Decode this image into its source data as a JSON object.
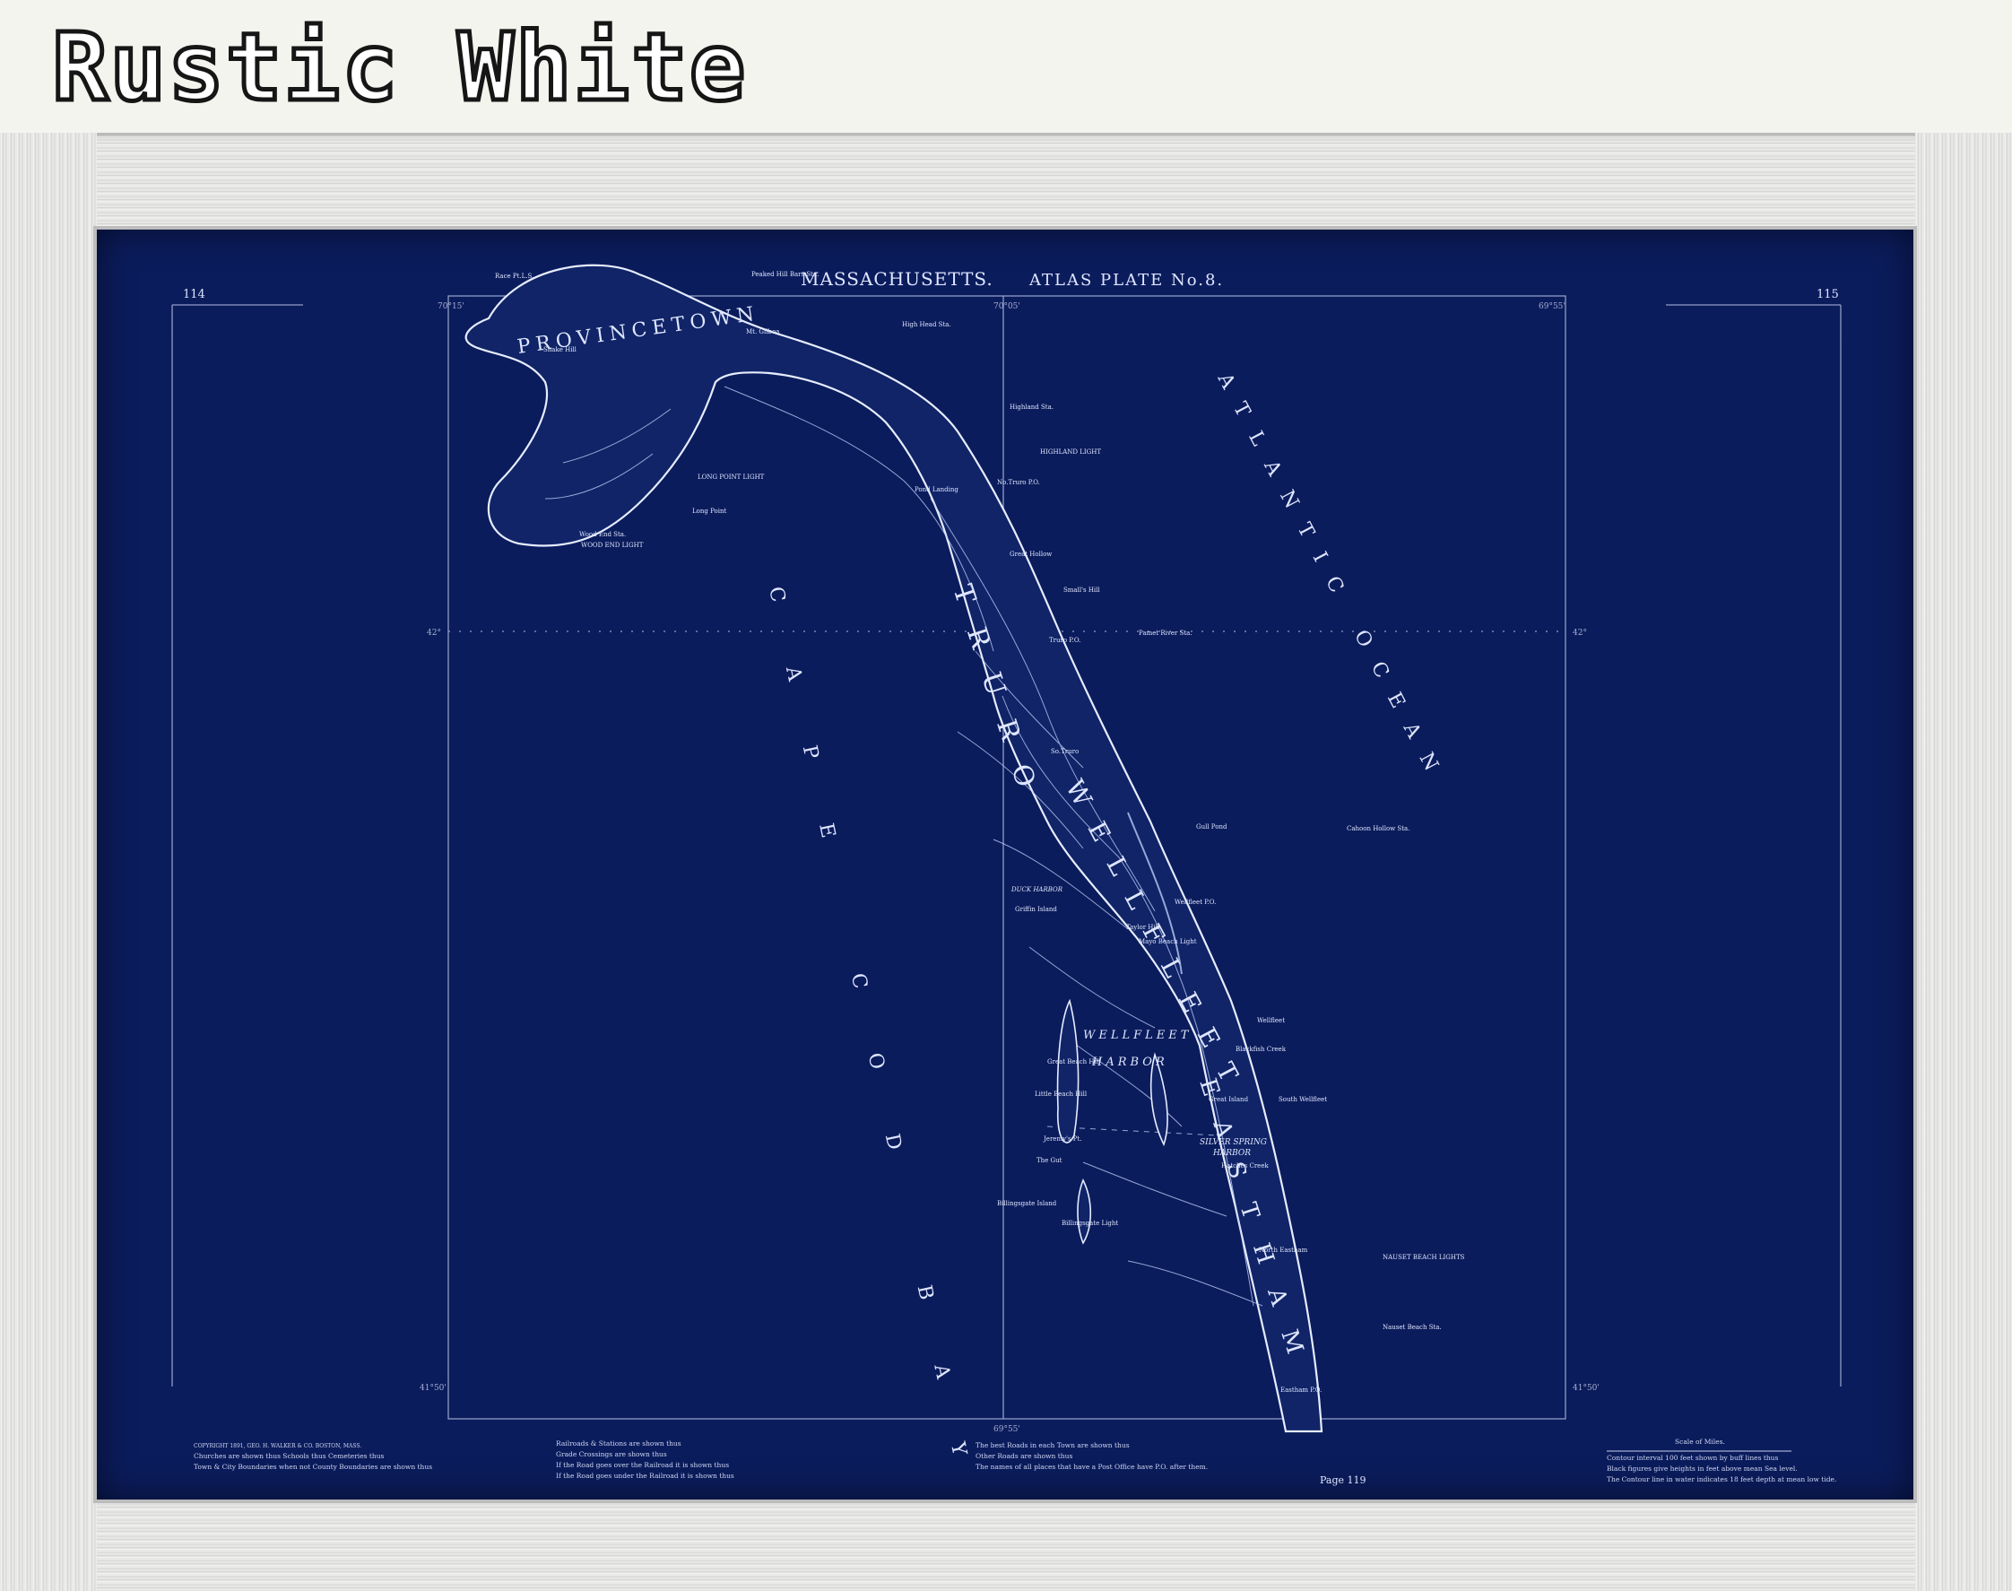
{
  "header": {
    "title": "Rustic White"
  },
  "colors": {
    "paper_blue": "#0b1c5c",
    "ink": "#dfe6ff",
    "frame": "#e6e6e3"
  },
  "map": {
    "plate_title": "MASSACHUSETTS.",
    "plate_subtitle": "ATLAS PLATE No.8.",
    "page_left": "114",
    "page_right": "115",
    "page_footer": "Page 119",
    "towns": [
      "PROVINCETOWN",
      "TRURO",
      "WELLFLEET",
      "EASTHAM"
    ],
    "water": {
      "ocean": "ATLANTIC OCEAN",
      "bay": "CAPE COD BAY",
      "harbor1": "WELLFLEET",
      "harbor2": "HARBOR",
      "harbor3": "SILVER SPRING",
      "harbor4": "HARBOR",
      "duck": "DUCK HARBOR"
    },
    "places": {
      "p1": "Race Pt.L.S.",
      "p2": "Peaked Hill Bars Sta.",
      "p3": "Snake Hill",
      "p4": "Mt. Gilboa",
      "p5": "High Head Sta.",
      "p6": "LONG POINT LIGHT",
      "p7": "Long Point",
      "p8": "Wood End Sta.",
      "p9": "WOOD END LIGHT",
      "p10": "Highland Sta.",
      "p11": "HIGHLAND LIGHT",
      "p12": "No.Truro P.O.",
      "p13": "Pond Landing",
      "p14": "Small's Hill",
      "p15": "Pamet River Sta.",
      "p16": "Truro P.O.",
      "p17": "So.Truro",
      "p18": "Great Hollow",
      "p19": "Griffin Island",
      "p20": "Taylor Hill",
      "p21": "Mayo Beach Light",
      "p22": "Cahoon Hollow Sta.",
      "p23": "Wellfleet P.O.",
      "p24": "Wellfleet",
      "p25": "Great Beach Hill",
      "p26": "Little Beach Hill",
      "p27": "Jeremy's Pt.",
      "p28": "The Gut",
      "p29": "Billingsgate Island",
      "p30": "Billingsgate Light",
      "p31": "Great Island",
      "p32": "Blackfish Creek",
      "p33": "South Wellfleet",
      "p34": "Hatches Creek",
      "p35": "North Eastham",
      "p36": "NAUSET BEACH LIGHTS",
      "p37": "Nauset Beach Sta.",
      "p38": "Eastham P.O.",
      "p39": "Gull Pond"
    },
    "legend": {
      "copyright": "COPYRIGHT 1891, GEO. H. WALKER & CO. BOSTON, MASS.",
      "l1": "Churches are shown thus  Schools thus  Cemeteries thus",
      "l2": "Town & City Boundaries when not County Boundaries are shown thus",
      "l3": "Railroads & Stations are shown thus",
      "l4": "Grade Crossings are shown thus",
      "l5": "If the Road goes over the Railroad it is shown thus",
      "l6": "If the Road goes under the Railroad it is shown thus",
      "l7": "The best Roads in each Town are shown thus",
      "l8": "Other Roads are shown thus",
      "l9": "The names of all places that have a Post Office have P.O. after them.",
      "scale": "Scale of Miles.",
      "c1": "Contour interval 100 feet shown by buff lines thus",
      "c2": "Black figures give heights in feet above mean Sea level.",
      "c3": "The Contour line in water indicates 18 feet depth at mean low tide."
    },
    "coords": {
      "top_left": "70°15'",
      "top_mid": "70°05'",
      "top_right": "69°55'",
      "lat_mid": "42°",
      "lat_low": "41°50'",
      "bottom_mid": "69°55'"
    }
  }
}
